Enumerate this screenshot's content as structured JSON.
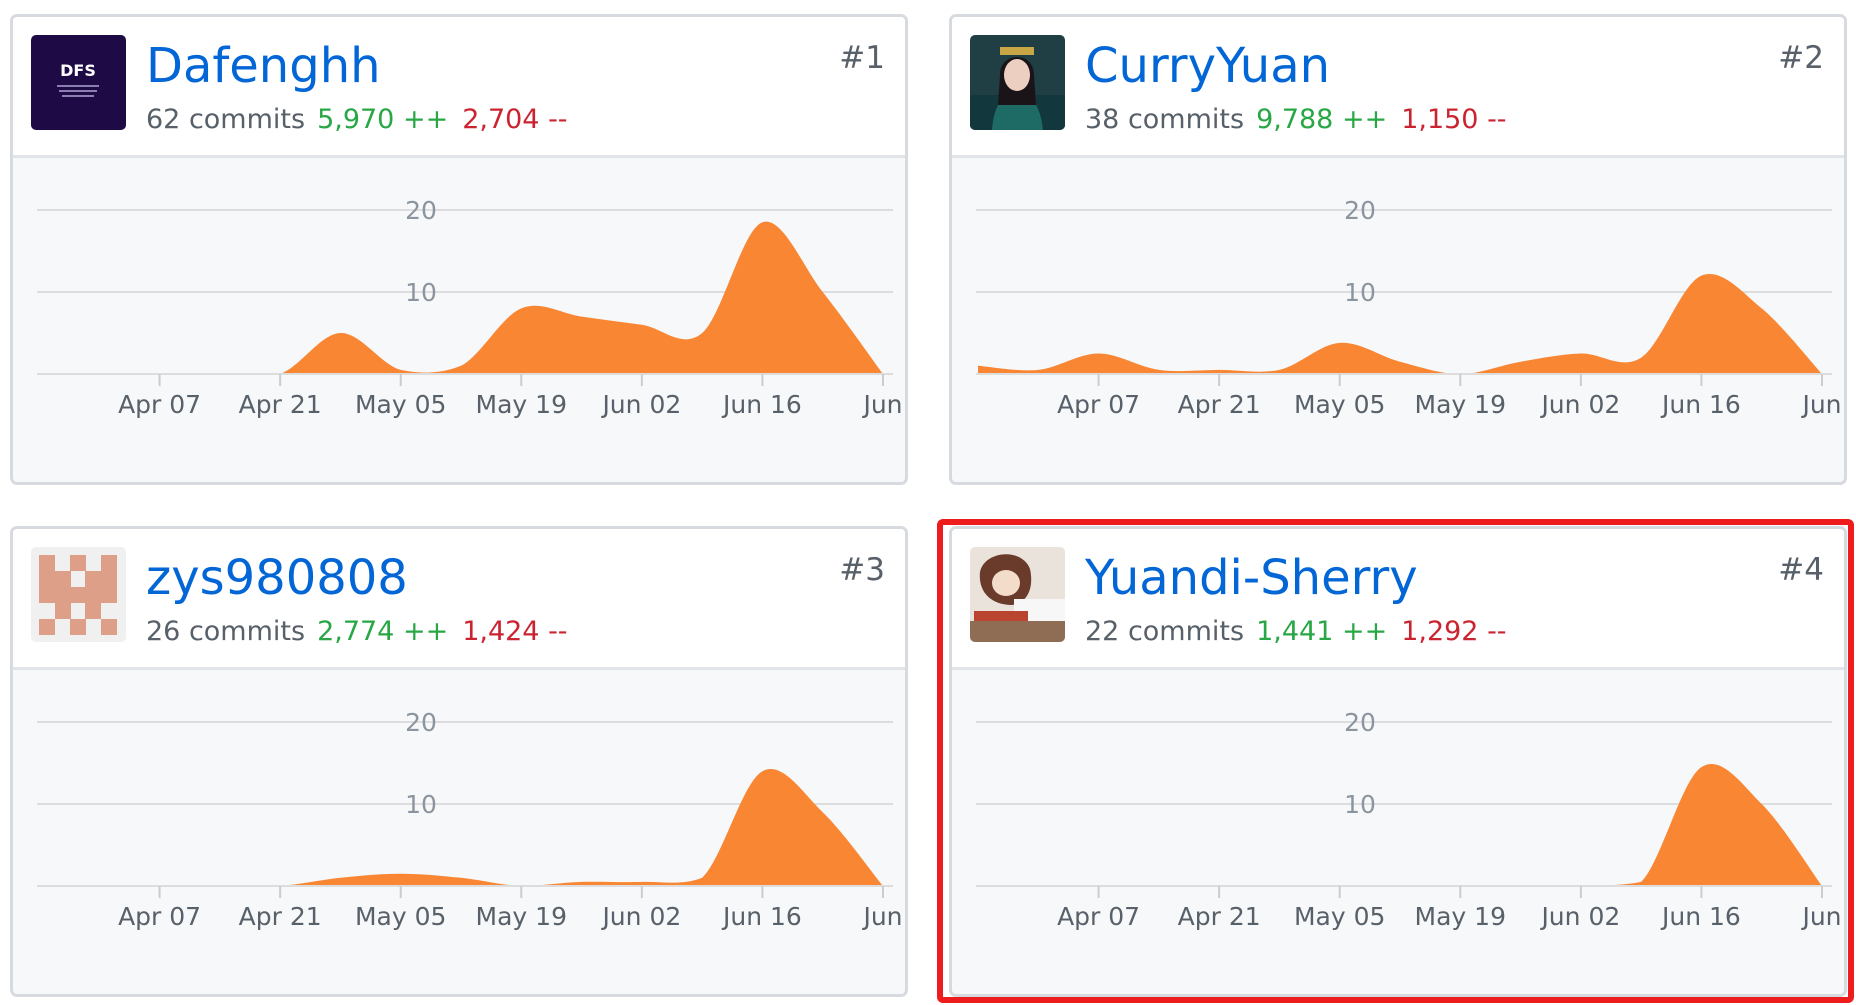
{
  "contributors": [
    {
      "name": "Dafenghh",
      "avatar_text": "DFS",
      "commits": "62 commits",
      "additions": "5,970 ++",
      "deletions": "2,704 --",
      "rank": "#1",
      "chart_data": {
        "type": "area",
        "x": [
          "2018-03-24",
          "2018-03-31",
          "2018-04-07",
          "2018-04-14",
          "2018-04-21",
          "2018-04-28",
          "2018-05-05",
          "2018-05-12",
          "2018-05-19",
          "2018-05-26",
          "2018-06-02",
          "2018-06-09",
          "2018-06-16",
          "2018-06-23",
          "2018-06-30"
        ],
        "values": [
          0,
          0,
          0,
          0,
          0,
          5,
          0.5,
          1,
          8,
          7,
          6,
          5,
          18.5,
          10,
          0
        ],
        "x_ticks": [
          "Apr 07",
          "Apr 21",
          "May 05",
          "May 19",
          "Jun 02",
          "Jun 16",
          "Jun"
        ],
        "y_ticks": [
          "10",
          "20"
        ],
        "ylim": [
          0,
          20
        ],
        "grid": true,
        "color": "#f98633"
      }
    },
    {
      "name": "CurryYuan",
      "avatar_text": "",
      "commits": "38 commits",
      "additions": "9,788 ++",
      "deletions": "1,150 --",
      "rank": "#2",
      "chart_data": {
        "type": "area",
        "x": [
          "2018-03-24",
          "2018-03-31",
          "2018-04-07",
          "2018-04-14",
          "2018-04-21",
          "2018-04-28",
          "2018-05-05",
          "2018-05-12",
          "2018-05-19",
          "2018-05-26",
          "2018-06-02",
          "2018-06-09",
          "2018-06-16",
          "2018-06-23",
          "2018-06-30"
        ],
        "values": [
          1,
          0.5,
          2.5,
          0.5,
          0.5,
          0.5,
          3.8,
          1.5,
          0,
          1.5,
          2.5,
          2,
          12,
          8,
          0
        ],
        "x_ticks": [
          "Apr 07",
          "Apr 21",
          "May 05",
          "May 19",
          "Jun 02",
          "Jun 16",
          "Jun"
        ],
        "y_ticks": [
          "10",
          "20"
        ],
        "ylim": [
          0,
          20
        ],
        "grid": true,
        "color": "#f98633"
      }
    },
    {
      "name": "zys980808",
      "avatar_text": "",
      "commits": "26 commits",
      "additions": "2,774 ++",
      "deletions": "1,424 --",
      "rank": "#3",
      "chart_data": {
        "type": "area",
        "x": [
          "2018-03-24",
          "2018-03-31",
          "2018-04-07",
          "2018-04-14",
          "2018-04-21",
          "2018-04-28",
          "2018-05-05",
          "2018-05-12",
          "2018-05-19",
          "2018-05-26",
          "2018-06-02",
          "2018-06-09",
          "2018-06-16",
          "2018-06-23",
          "2018-06-30"
        ],
        "values": [
          0,
          0,
          0,
          0,
          0,
          1,
          1.5,
          1,
          0,
          0.5,
          0.5,
          1,
          14,
          9,
          0
        ],
        "x_ticks": [
          "Apr 07",
          "Apr 21",
          "May 05",
          "May 19",
          "Jun 02",
          "Jun 16",
          "Jun"
        ],
        "y_ticks": [
          "10",
          "20"
        ],
        "ylim": [
          0,
          20
        ],
        "grid": true,
        "color": "#f98633"
      }
    },
    {
      "name": "Yuandi-Sherry",
      "avatar_text": "",
      "commits": "22 commits",
      "additions": "1,441 ++",
      "deletions": "1,292 --",
      "rank": "#4",
      "highlighted": true,
      "chart_data": {
        "type": "area",
        "x": [
          "2018-03-24",
          "2018-03-31",
          "2018-04-07",
          "2018-04-14",
          "2018-04-21",
          "2018-04-28",
          "2018-05-05",
          "2018-05-12",
          "2018-05-19",
          "2018-05-26",
          "2018-06-02",
          "2018-06-09",
          "2018-06-16",
          "2018-06-23",
          "2018-06-30"
        ],
        "values": [
          0,
          0,
          0,
          0,
          0,
          0,
          0,
          0,
          0,
          0,
          0,
          0.5,
          14.5,
          10,
          0
        ],
        "x_ticks": [
          "Apr 07",
          "Apr 21",
          "May 05",
          "May 19",
          "Jun 02",
          "Jun 16",
          "Jun"
        ],
        "y_ticks": [
          "10",
          "20"
        ],
        "ylim": [
          0,
          20
        ],
        "grid": true,
        "color": "#f98633"
      }
    }
  ],
  "colors": {
    "link": "#0366d6",
    "additions": "#28a745",
    "deletions": "#cb2431",
    "area": "#f98633",
    "highlight": "#ee1c1c"
  }
}
